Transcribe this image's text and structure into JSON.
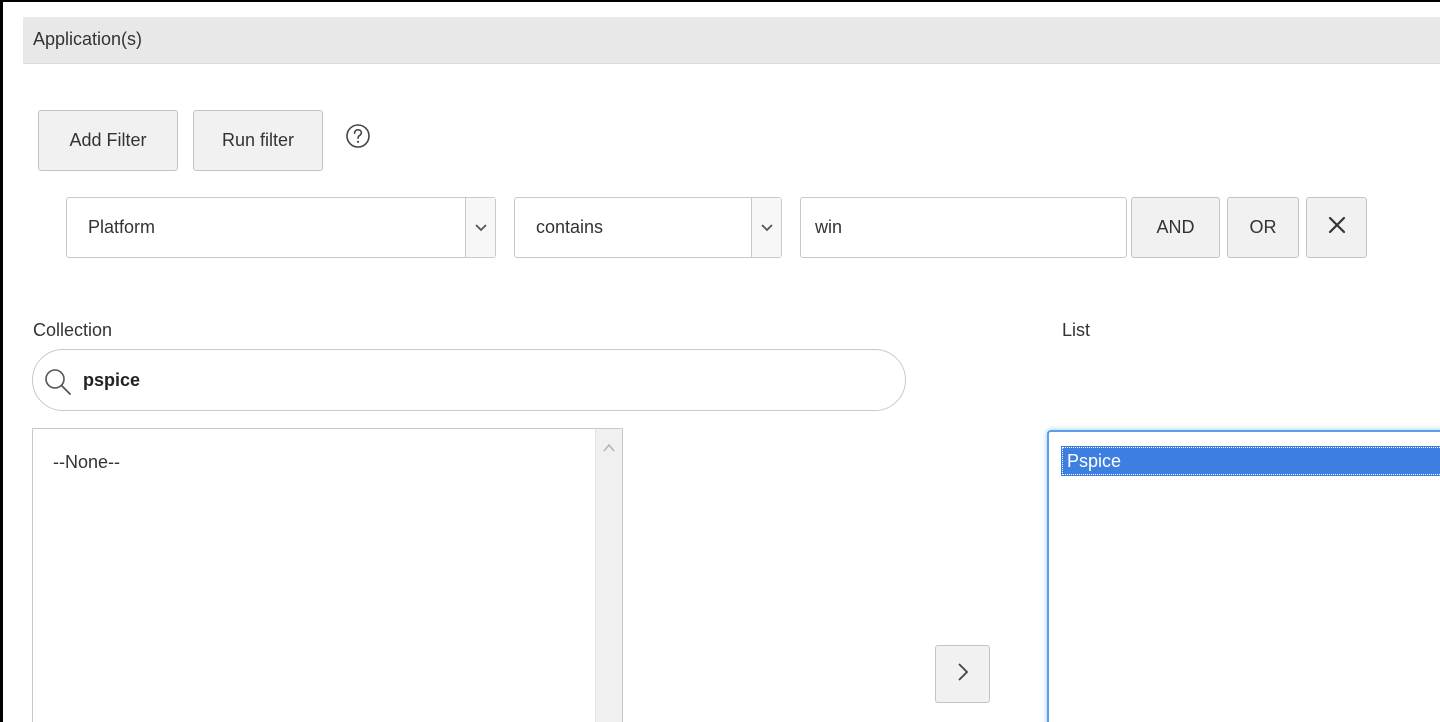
{
  "section": {
    "title": "Application(s)"
  },
  "toolbar": {
    "add_filter_label": "Add Filter",
    "run_filter_label": "Run filter",
    "help_icon": "help-circle-icon"
  },
  "filter": {
    "field_value": "Platform",
    "operator_value": "contains",
    "value": "win",
    "and_label": "AND",
    "or_label": "OR",
    "remove_icon": "close-icon"
  },
  "collection": {
    "label": "Collection",
    "search_value": "pspice",
    "items": [
      "--None--"
    ]
  },
  "list": {
    "label": "List",
    "items": [
      "Pspice"
    ],
    "selected": "Pspice"
  },
  "move_button": {
    "icon": "chevron-right-icon"
  },
  "colors": {
    "header_bg": "#e8e8e8",
    "selection": "#3d7fe0",
    "focus_border": "#5aa0e8"
  }
}
